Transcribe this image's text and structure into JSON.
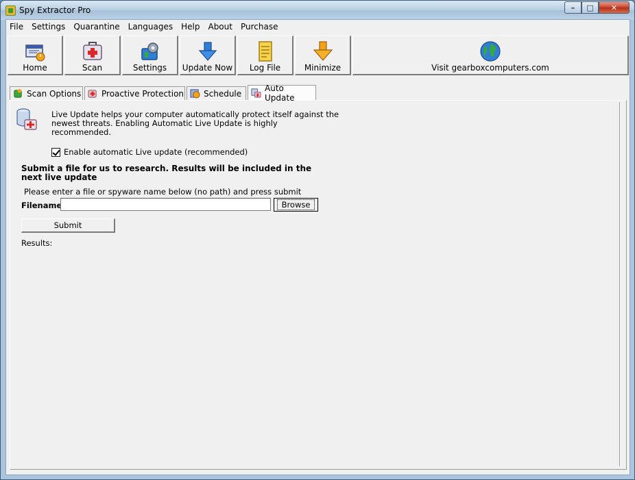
{
  "window": {
    "title": "Spy Extractor Pro",
    "controls": {
      "minimize": "–",
      "maximize": "□",
      "close": "✕"
    }
  },
  "menu": [
    "File",
    "Settings",
    "Quarantine",
    "Languages",
    "Help",
    "About",
    "Purchase"
  ],
  "toolbar": {
    "home": "Home",
    "scan": "Scan",
    "settings": "Settings",
    "update_now": "Update Now",
    "log_file": "Log File",
    "minimize": "Minimize",
    "visit": "Visit gearboxcomputers.com"
  },
  "tabs": [
    "Scan Options",
    "Proactive Protection",
    "Schedule",
    "Auto Update"
  ],
  "active_tab": "Auto Update",
  "auto_update": {
    "description": "Live Update helps your computer automatically protect itself against the newest threats.  Enabling Automatic Live Update is highly recommended.",
    "enable_checkbox_label": "Enable automatic Live update (recommended)",
    "enable_checked": true,
    "submit_heading": "Submit a file for us to research.  Results will be included in the next live update",
    "instructions": "Please enter a file or spyware name below (no path) and press submit",
    "filename_label": "Filename:",
    "filename_value": "",
    "browse_label": "Browse",
    "submit_label": "Submit",
    "results_label": "Results:"
  },
  "icons": {
    "app": "app-icon",
    "home": "home-icon",
    "scan": "first-aid-kit-icon",
    "settings": "settings-icon",
    "update_now": "download-arrow-icon",
    "log_file": "document-icon",
    "minimize": "down-arrow-icon",
    "visit": "globe-icon",
    "live_update": "database-update-icon"
  },
  "colors": {
    "titlebar": "#b6cde2",
    "client_bg": "#f0f0f0",
    "close_button": "#c7432c",
    "accent_orange": "#f2a21a",
    "accent_blue": "#2f7fd6",
    "accent_green": "#38a83a"
  }
}
